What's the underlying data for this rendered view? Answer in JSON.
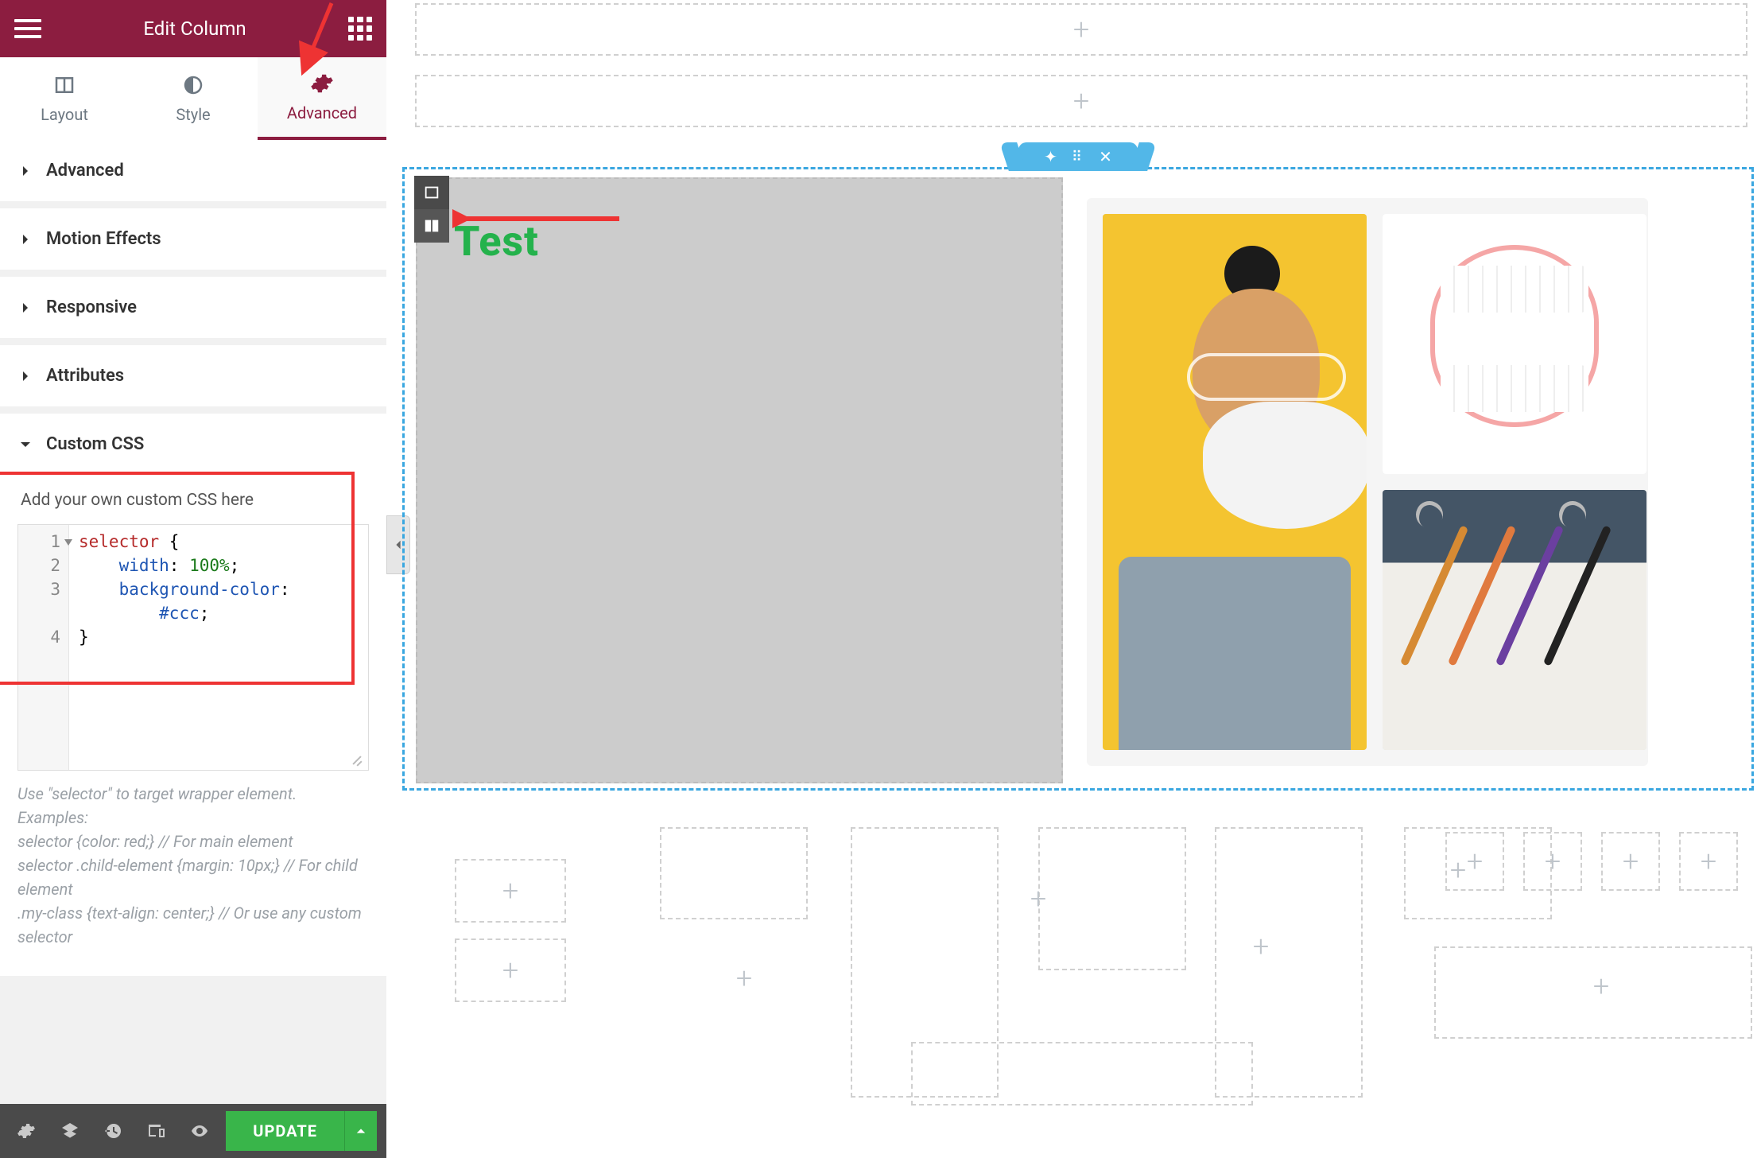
{
  "header": {
    "title": "Edit Column"
  },
  "tabs": {
    "layout": "Layout",
    "style": "Style",
    "advanced": "Advanced",
    "active": "advanced"
  },
  "accordions": {
    "advanced": "Advanced",
    "motion": "Motion Effects",
    "responsive": "Responsive",
    "attributes": "Attributes",
    "customcss": "Custom CSS"
  },
  "customcss": {
    "label": "Add your own custom CSS here",
    "lines": [
      "1",
      "2",
      "3",
      "",
      "4"
    ],
    "code": {
      "l1_sel": "selector",
      "l1_brace": " {",
      "l2_prop": "width",
      "l2_colon": ": ",
      "l2_val": "100%",
      "l2_semi": ";",
      "l3_prop": "background-color",
      "l3_colon": ":",
      "l3b_hex": "#ccc",
      "l3b_semi": ";",
      "l4_brace": "}"
    },
    "hint1": "Use \"selector\" to target wrapper element.",
    "hint2": "Examples:",
    "hint3": "selector {color: red;} // For main element",
    "hint4": "selector .child-element {margin: 10px;} // For child element",
    "hint5": ".my-class {text-align: center;} // Or use any custom selector"
  },
  "footer": {
    "update": "UPDATE"
  },
  "canvas": {
    "test_label": "Test"
  }
}
